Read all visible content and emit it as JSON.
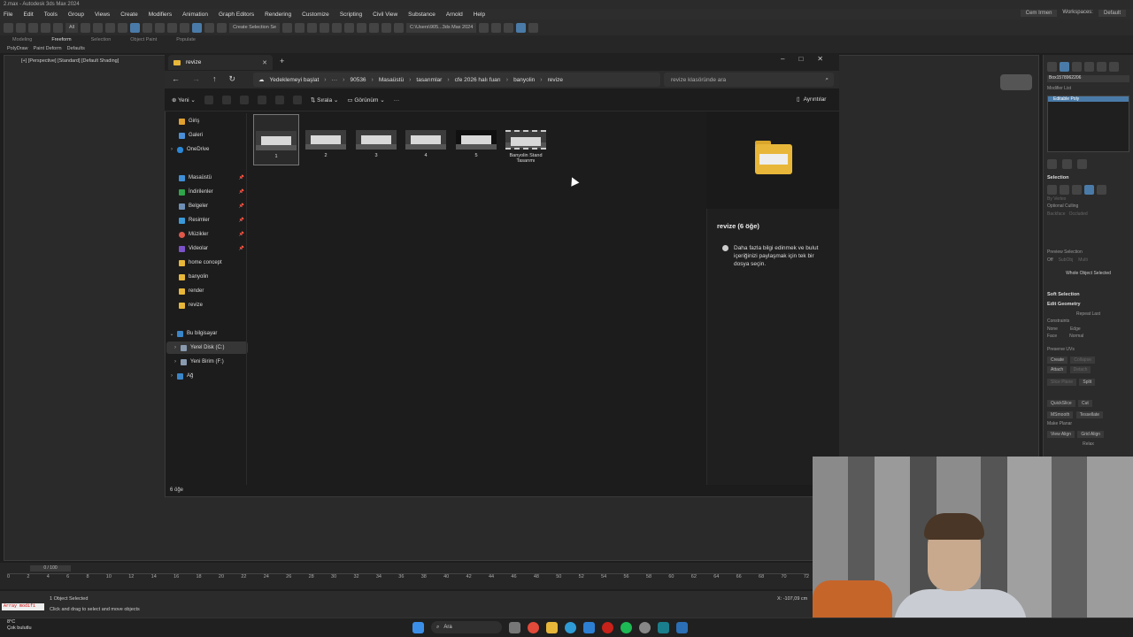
{
  "max": {
    "title": "2.max - Autodesk 3ds Max 2024",
    "menu": [
      "File",
      "Edit",
      "Tools",
      "Group",
      "Views",
      "Create",
      "Modifiers",
      "Animation",
      "Graph Editors",
      "Rendering",
      "Customize",
      "Scripting",
      "Civil View",
      "Substance",
      "Arnold",
      "Help"
    ],
    "user": "Cem Irmen",
    "workspace_label": "Workspaces:",
    "workspace_value": "Default",
    "selection_filter": "All",
    "create_selection_set": "Create Selection Se",
    "project_path": "C:\\Users\\905...3ds Max 2024",
    "ribbon_tabs": [
      "Modeling",
      "Freeform",
      "Selection",
      "Object Paint",
      "Populate"
    ],
    "ribbon_sub": [
      "PolyDraw",
      "Paint Deform",
      "Defaults"
    ],
    "viewport_label": "[+] [Perspective] [Standard] [Default Shading]",
    "command_panel": {
      "object_name": "Box1578962206",
      "modifier_list": "Modifier List",
      "stack_item": "Editable Poly",
      "selection_head": "Selection",
      "by_vertex": "By Vertex",
      "optional_culling": "Optional Culling",
      "backface": "Backface",
      "occluded": "Occluded",
      "preview_selection": "Preview Selection",
      "off": "Off",
      "subobj": "SubObj",
      "multi": "Multi",
      "whole_object_selected": "Whole Object Selected",
      "soft_selection": "Soft Selection",
      "edit_geometry": "Edit Geometry",
      "repeat_last": "Repeat Last",
      "constraints": "Constraints",
      "none": "None",
      "edge": "Edge",
      "face": "Face",
      "normal": "Normal",
      "preserve_uvs": "Preserve UVs",
      "create": "Create",
      "collapse": "Collapse",
      "attach": "Attach",
      "detach": "Detach",
      "slice_plane": "Slice Plane",
      "split": "Split",
      "quickslice": "QuickSlice",
      "cut": "Cut",
      "msmooth": "MSmooth",
      "tessellate": "Tessellate",
      "make_planar": "Make Planar",
      "view_align": "View Align",
      "grid_align": "Grid Align",
      "relax": "Relax"
    },
    "timeline": {
      "frame_counter": "0 / 100",
      "ticks": [
        "0",
        "2",
        "4",
        "6",
        "8",
        "10",
        "12",
        "14",
        "16",
        "18",
        "20",
        "22",
        "24",
        "26",
        "28",
        "30",
        "32",
        "34",
        "36",
        "38",
        "40",
        "42",
        "44",
        "46",
        "48",
        "50",
        "52",
        "54",
        "56",
        "58",
        "60",
        "62",
        "64",
        "66",
        "68",
        "70",
        "72"
      ]
    },
    "status": {
      "maxscript": "Array modifi",
      "objects_selected": "1 Object Selected",
      "hint": "Click and drag to select and move objects",
      "coord_x": "X: -107,09 cm"
    }
  },
  "taskbar": {
    "temp": "8°C",
    "weather": "Çok bulutlu",
    "search_placeholder": "Ara"
  },
  "explorer": {
    "tab_title": "revize",
    "breadcrumb": [
      "Yedeklemeyi başlat",
      "···",
      "90536",
      "Masaüstü",
      "tasarımlar",
      "cfe 2026 halı fuarı",
      "banyolin",
      "revize"
    ],
    "search_placeholder": "revize klasöründe ara",
    "toolbar": {
      "new": "Yeni",
      "sort": "Sırala",
      "view": "Görünüm",
      "more": "···",
      "details": "Ayrıntılar"
    },
    "nav": {
      "home": "Giriş",
      "gallery": "Galeri",
      "onedrive": "OneDrive",
      "desktop": "Masaüstü",
      "downloads": "İndirilenler",
      "documents": "Belgeler",
      "pictures": "Resimler",
      "music": "Müzikler",
      "videos": "Videolar",
      "home_concept": "home concept",
      "banyolin": "banyolin",
      "render": "render",
      "revize": "revize",
      "this_pc": "Bu bilgisayar",
      "local_disk": "Yerel Disk (C:)",
      "new_volume": "Yeni Birim (F:)",
      "network": "Ağ"
    },
    "files": [
      {
        "name": "1"
      },
      {
        "name": "2"
      },
      {
        "name": "3"
      },
      {
        "name": "4"
      },
      {
        "name": "5"
      },
      {
        "name": "Banyolin Stand Tasarımı"
      }
    ],
    "details_pane": {
      "title": "revize (6 öğe)",
      "info": "Daha fazla bilgi edinmek ve bulut içeriğinizi paylaşmak için tek bir dosya seçin."
    },
    "status_count": "6 öğe"
  },
  "colors": {
    "folder": "#e8b73a",
    "accent": "#4a7ba8"
  }
}
